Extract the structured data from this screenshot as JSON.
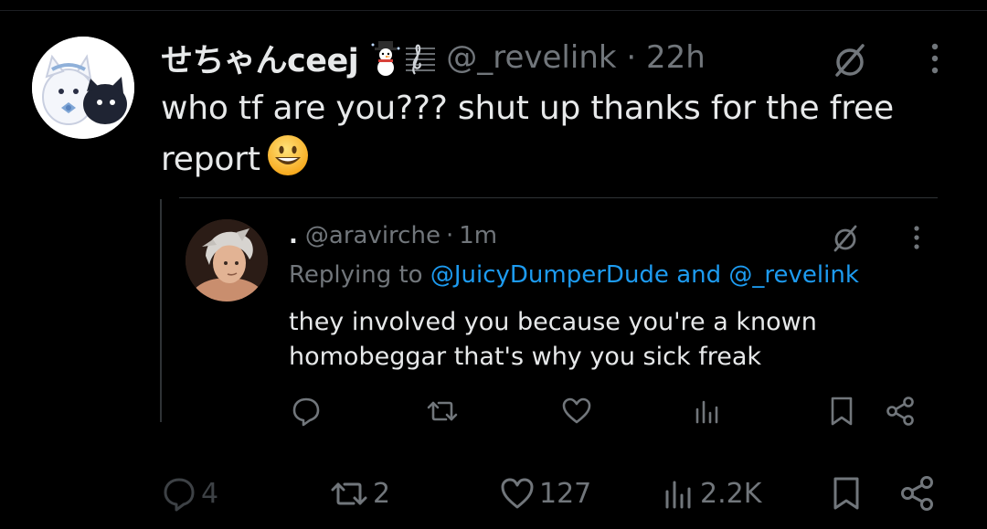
{
  "post": {
    "display_name": "せちゃんceej",
    "handle": "@_revelink",
    "separator": "·",
    "time": "22h",
    "text": "who tf are you??? shut up thanks for the free report"
  },
  "quoted_reply": {
    "name_prefix": ".",
    "handle": "@aravirche",
    "separator": "·",
    "time": "1m",
    "replying_to_label": "Replying to",
    "mention_1": "@JuicyDumperDude",
    "and_label": "and",
    "mention_2": "@_revelink",
    "text_line_1": "they involved you because you're a known",
    "text_line_2": "homobeggar that's why you sick freak"
  },
  "actions": {
    "replies": "4",
    "reposts": "2",
    "likes": "127",
    "views": "2.2K"
  },
  "icons": {
    "grok": "grok-slash-icon",
    "more": "more-vertical-icon",
    "reply": "reply-bubble-icon",
    "repost": "repost-arrows-icon",
    "like": "heart-icon",
    "views": "analytics-bars-icon",
    "bookmark": "bookmark-icon",
    "share": "share-icon"
  },
  "colors": {
    "background": "#000000",
    "text_primary": "#e7e9ea",
    "text_secondary": "#71767b",
    "link": "#1d9bf0",
    "divider": "#2f3336"
  }
}
